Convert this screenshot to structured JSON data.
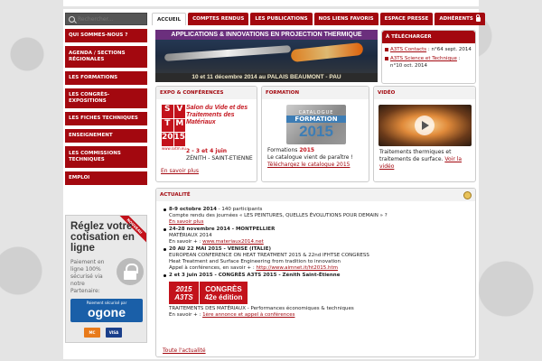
{
  "search": {
    "placeholder": "Rechercher..."
  },
  "leftnav": [
    "QUI SOMMES-NOUS ?",
    "AGENDA / SECTIONS RÉGIONALES",
    "LES FORMATIONS",
    "LES CONGRÈS-EXPOSITIONS",
    "LES FICHES TECHNIQUES",
    "ENSEIGNEMENT",
    "LES COMMISSIONS TECHNIQUES",
    "EMPLOI"
  ],
  "tabs": [
    "ACCUEIL",
    "COMPTES RENDUS",
    "LES PUBLICATIONS",
    "NOS LIENS FAVORIS",
    "ESPACE PRESSE",
    "ADHÉRENTS"
  ],
  "banner": {
    "title": "APPLICATIONS & INNOVATIONS EN PROJECTION THERMIQUE",
    "footer": "10 et 11 décembre 2014 au PALAIS BEAUMONT - PAU"
  },
  "download": {
    "title": "À TÉLÉCHARGER",
    "items": [
      {
        "link": "A3TS Contacts",
        "text": ": n°64 sept. 2014"
      },
      {
        "link": "A3TS Science et Technique",
        "text": ": n°10 oct. 2014"
      }
    ]
  },
  "expo": {
    "title": "EXPO & CONFÉRENCES",
    "logo_letters": [
      "S",
      "V",
      "T",
      "M",
      "20",
      "15"
    ],
    "logo_text": "Salon du Vide et des Traitements des Matériaux",
    "logo_url": "www.svtm.eu",
    "dates": "2 - 3 et 4 juin",
    "place": "ZÉNITH - SAINT-ETIENNE",
    "link": "En savoir plus"
  },
  "formation": {
    "title": "FORMATION",
    "cat1": "CATALOGUE",
    "cat2": "FORMATION",
    "cat3": "2015",
    "line1_a": "Formations",
    "line1_b": "2015",
    "line2": "Le catalogue vient de paraître !",
    "link": "Téléchargez le catalogue 2015"
  },
  "video": {
    "title": "VIDÉO",
    "text": "Traitements thermiques et traitements de surface.",
    "link": "Voir la vidéo"
  },
  "news": {
    "title": "ACTUALITÉ",
    "n1_date": "8-9 octobre 2014",
    "n1_rest": " - 140 participants",
    "n1_line2": "Compte rendu des journées « LES PEINTURES, QUELLES ÉVOLUTIONS POUR DEMAIN » ?",
    "n1_link": "En savoir plus",
    "n2_head": "24-28 novembre 2014 - MONTPELLIER",
    "n2_line2": "MATÉRIAUX 2014",
    "n2_prefix": "En savoir + :",
    "n2_link": "www.materiaux2014.net",
    "n3_head": "20 AU 22 MAI 2015 - VENISE (ITALIE)",
    "n3_line2": "EUROPEAN CONFERENCE ON HEAT TREATMENT 2015 & 22nd IFHTSE CONGRESS",
    "n3_line3": "Heat Treatment and Surface Engineering from tradition to innovation",
    "n3_prefix": "Appel à conférences, en savoir + :",
    "n3_link": "http://www.aimnet.it/ht2015.htm",
    "n4_head": "2 et 3 juin 2015 - CONGRÈS A3TS 2015 - Zénith Saint-Étienne",
    "a3ts_l1": "2015",
    "a3ts_l2": "A3TS",
    "a3ts_r1": "CONGRÈS",
    "a3ts_r2": "42e édition",
    "n4_line2": "TRAITEMENTS DES MATÉRIAUX - Performances économiques & techniques",
    "n4_prefix": "En savoir + :",
    "n4_link": "1ère annonce et appel à conférences",
    "all": "Toute l'actualité"
  },
  "ad": {
    "ribbon": "NOUVEAU",
    "heading": "Réglez votre cotisation en ligne",
    "text": "Paiement en ligne 100% sécurisé via notre Partenaire:",
    "ogone_small": "Paiement sécurisé par",
    "ogone": "ogone",
    "cards": [
      "MC",
      "VISA"
    ]
  }
}
